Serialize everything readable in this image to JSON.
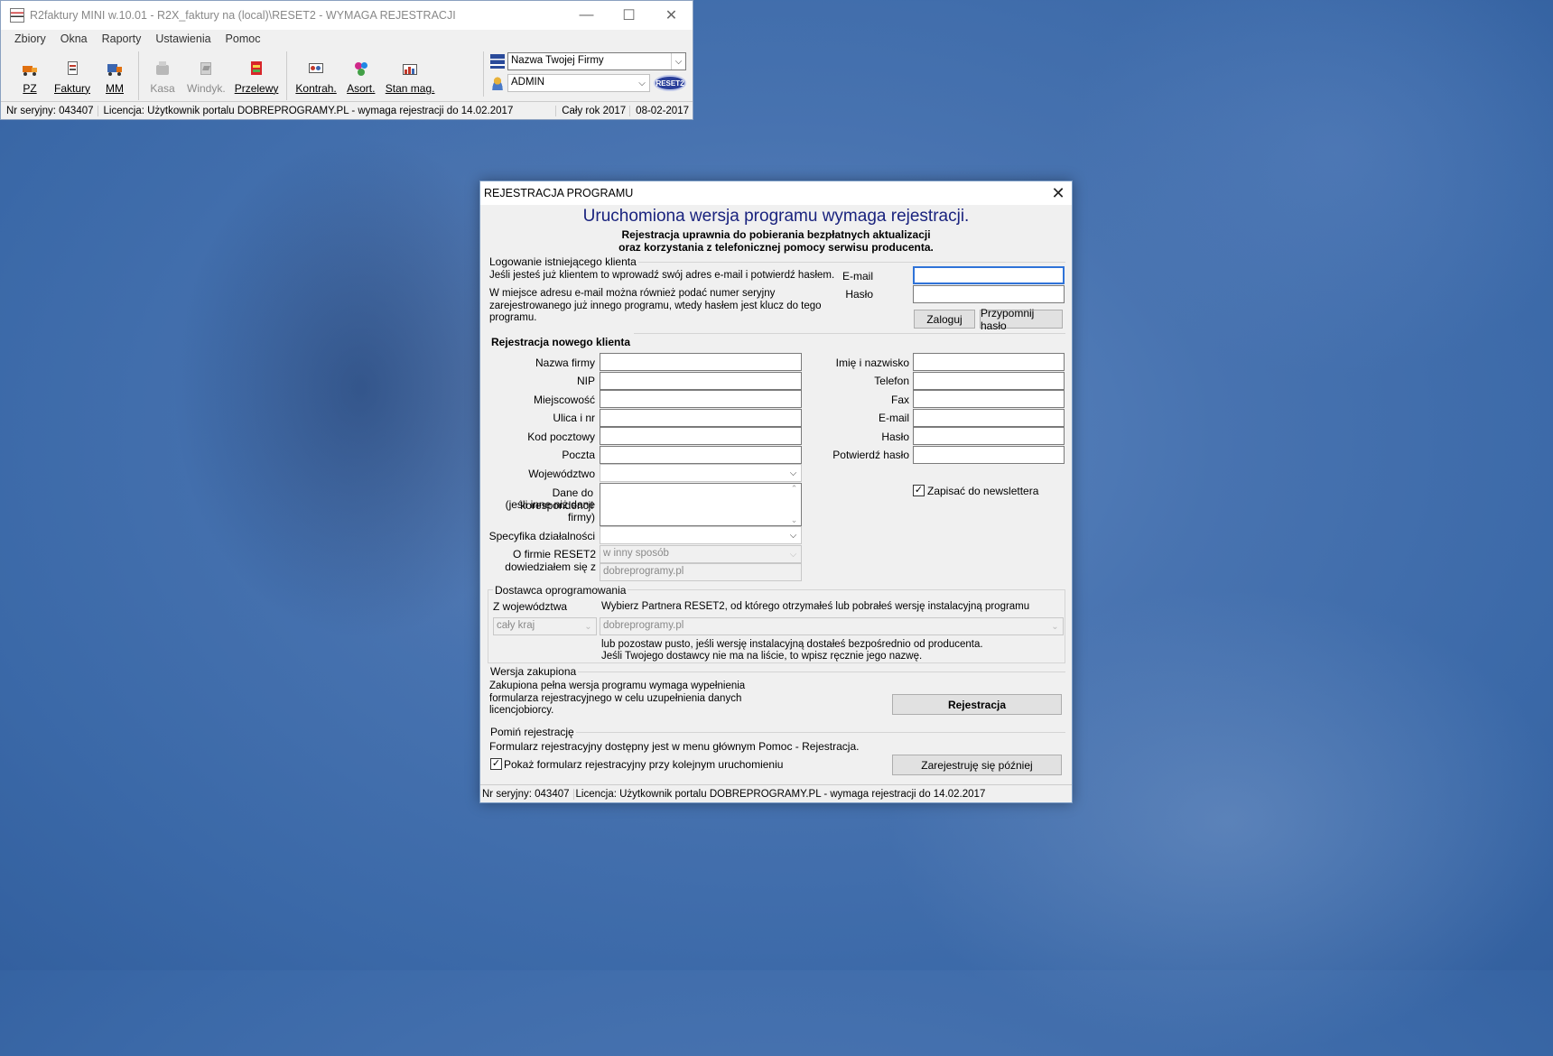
{
  "main_window": {
    "title": "R2faktury MINI w.10.01 - R2X_faktury na (local)\\RESET2 - WYMAGA REJESTRACJI",
    "controls": {
      "minimize": "—",
      "maximize": "☐",
      "close": "✕"
    },
    "menu": [
      "Zbiory",
      "Okna",
      "Raporty",
      "Ustawienia",
      "Pomoc"
    ],
    "toolbar": {
      "group1": [
        {
          "label": "PZ",
          "icon": "truck-icon",
          "enabled": true
        },
        {
          "label": "Faktury",
          "icon": "invoice-icon",
          "enabled": true
        },
        {
          "label": "MM",
          "icon": "truck-transfer-icon",
          "enabled": true
        }
      ],
      "group2": [
        {
          "label": "Kasa",
          "icon": "cash-register-icon",
          "enabled": false
        },
        {
          "label": "Windyk.",
          "icon": "collection-icon",
          "enabled": false
        },
        {
          "label": "Przelewy",
          "icon": "transfer-icon",
          "enabled": true
        }
      ],
      "group3": [
        {
          "label": "Kontrah.",
          "icon": "contractors-icon",
          "enabled": true
        },
        {
          "label": "Asort.",
          "icon": "assortment-icon",
          "enabled": true
        },
        {
          "label": "Stan mag.",
          "icon": "warehouse-icon",
          "enabled": true
        }
      ]
    },
    "company_select": "Nazwa Twojej Firmy",
    "user_select": "ADMIN",
    "logo_text": "RESET2",
    "status": {
      "serial": "Nr seryjny: 043407",
      "license": "Licencja: Użytkownik portalu DOBREPROGRAMY.PL - wymaga rejestracji do 14.02.2017",
      "period": "Cały rok 2017",
      "date": "08-02-2017"
    }
  },
  "dialog": {
    "title": "REJESTRACJA PROGRAMU",
    "close": "✕",
    "heading": "Uruchomiona wersja programu wymaga rejestracji.",
    "subheading_1": "Rejestracja uprawnia do pobierania bezpłatnych aktualizacji",
    "subheading_2": "oraz korzystania z telefonicznej pomocy serwisu producenta.",
    "login": {
      "group_label": "Logowanie istniejącego klienta",
      "info_1": "Jeśli jesteś już klientem to wprowadź swój adres e-mail i potwierdź hasłem.",
      "info_2": "W miejsce adresu e-mail można również podać numer seryjny zarejestrowanego już innego programu, wtedy hasłem jest klucz do tego programu.",
      "email_label": "E-mail",
      "password_label": "Hasło",
      "email_value": "",
      "password_value": "",
      "login_button": "Zaloguj",
      "remind_button": "Przypomnij hasło"
    },
    "new_client": {
      "group_label": "Rejestracja nowego klienta",
      "left_fields": [
        {
          "label": "Nazwa firmy",
          "value": ""
        },
        {
          "label": "NIP",
          "value": ""
        },
        {
          "label": "Miejscowość",
          "value": ""
        },
        {
          "label": "Ulica i nr",
          "value": ""
        },
        {
          "label": "Kod pocztowy",
          "value": ""
        },
        {
          "label": "Poczta",
          "value": ""
        }
      ],
      "voivodeship_label": "Województwo",
      "voivodeship_value": "",
      "correspondence_label_1": "Dane do korespondencji",
      "correspondence_label_2": "(jeśli inne niż dane firmy)",
      "correspondence_value": "",
      "specifics_label": "Specyfika działalności",
      "specifics_value": "",
      "source_label_1": "O firmie RESET2",
      "source_label_2": "dowiedziałem się z",
      "source_select": "w inny sposób",
      "source_detail": "dobreprogramy.pl",
      "right_fields": [
        {
          "label": "Imię i nazwisko",
          "value": ""
        },
        {
          "label": "Telefon",
          "value": ""
        },
        {
          "label": "Fax",
          "value": ""
        },
        {
          "label": "E-mail",
          "value": ""
        },
        {
          "label": "Hasło",
          "value": ""
        },
        {
          "label": "Potwierdź hasło",
          "value": ""
        }
      ],
      "newsletter_label": "Zapisać do newslettera",
      "newsletter_checked": true
    },
    "supplier": {
      "group_label": "Dostawca oprogramowania",
      "region_label": "Z województwa",
      "region_value": "cały kraj",
      "partner_label": "Wybierz Partnera RESET2, od którego otrzymałeś lub pobrałeś wersję instalacyjną programu",
      "partner_value": "dobreprogramy.pl",
      "hint_1": "lub pozostaw pusto, jeśli wersję instalacyjną dostałeś bezpośrednio od producenta.",
      "hint_2": "Jeśli Twojego dostawcy nie ma na liście, to wpisz ręcznie jego nazwę."
    },
    "purchased": {
      "group_label": "Wersja zakupiona",
      "info": "Zakupiona pełna wersja programu wymaga wypełnienia formularza rejestracyjnego w celu uzupełnienia danych licencjobiorcy.",
      "register_button": "Rejestracja"
    },
    "skip": {
      "group_label": "Pomiń rejestrację",
      "info": "Formularz rejestracyjny dostępny jest w menu głównym Pomoc - Rejestracja.",
      "show_label": "Pokaż formularz rejestracyjny przy kolejnym uruchomieniu",
      "show_checked": true,
      "later_button": "Zarejestruję się później"
    },
    "status": {
      "serial": "Nr seryjny: 043407",
      "license": "Licencja: Użytkownik portalu DOBREPROGRAMY.PL - wymaga rejestracji do 14.02.2017"
    }
  },
  "colors": {
    "heading": "#1a237e",
    "desktop": "#4873b0",
    "focus": "#2f73d8"
  }
}
